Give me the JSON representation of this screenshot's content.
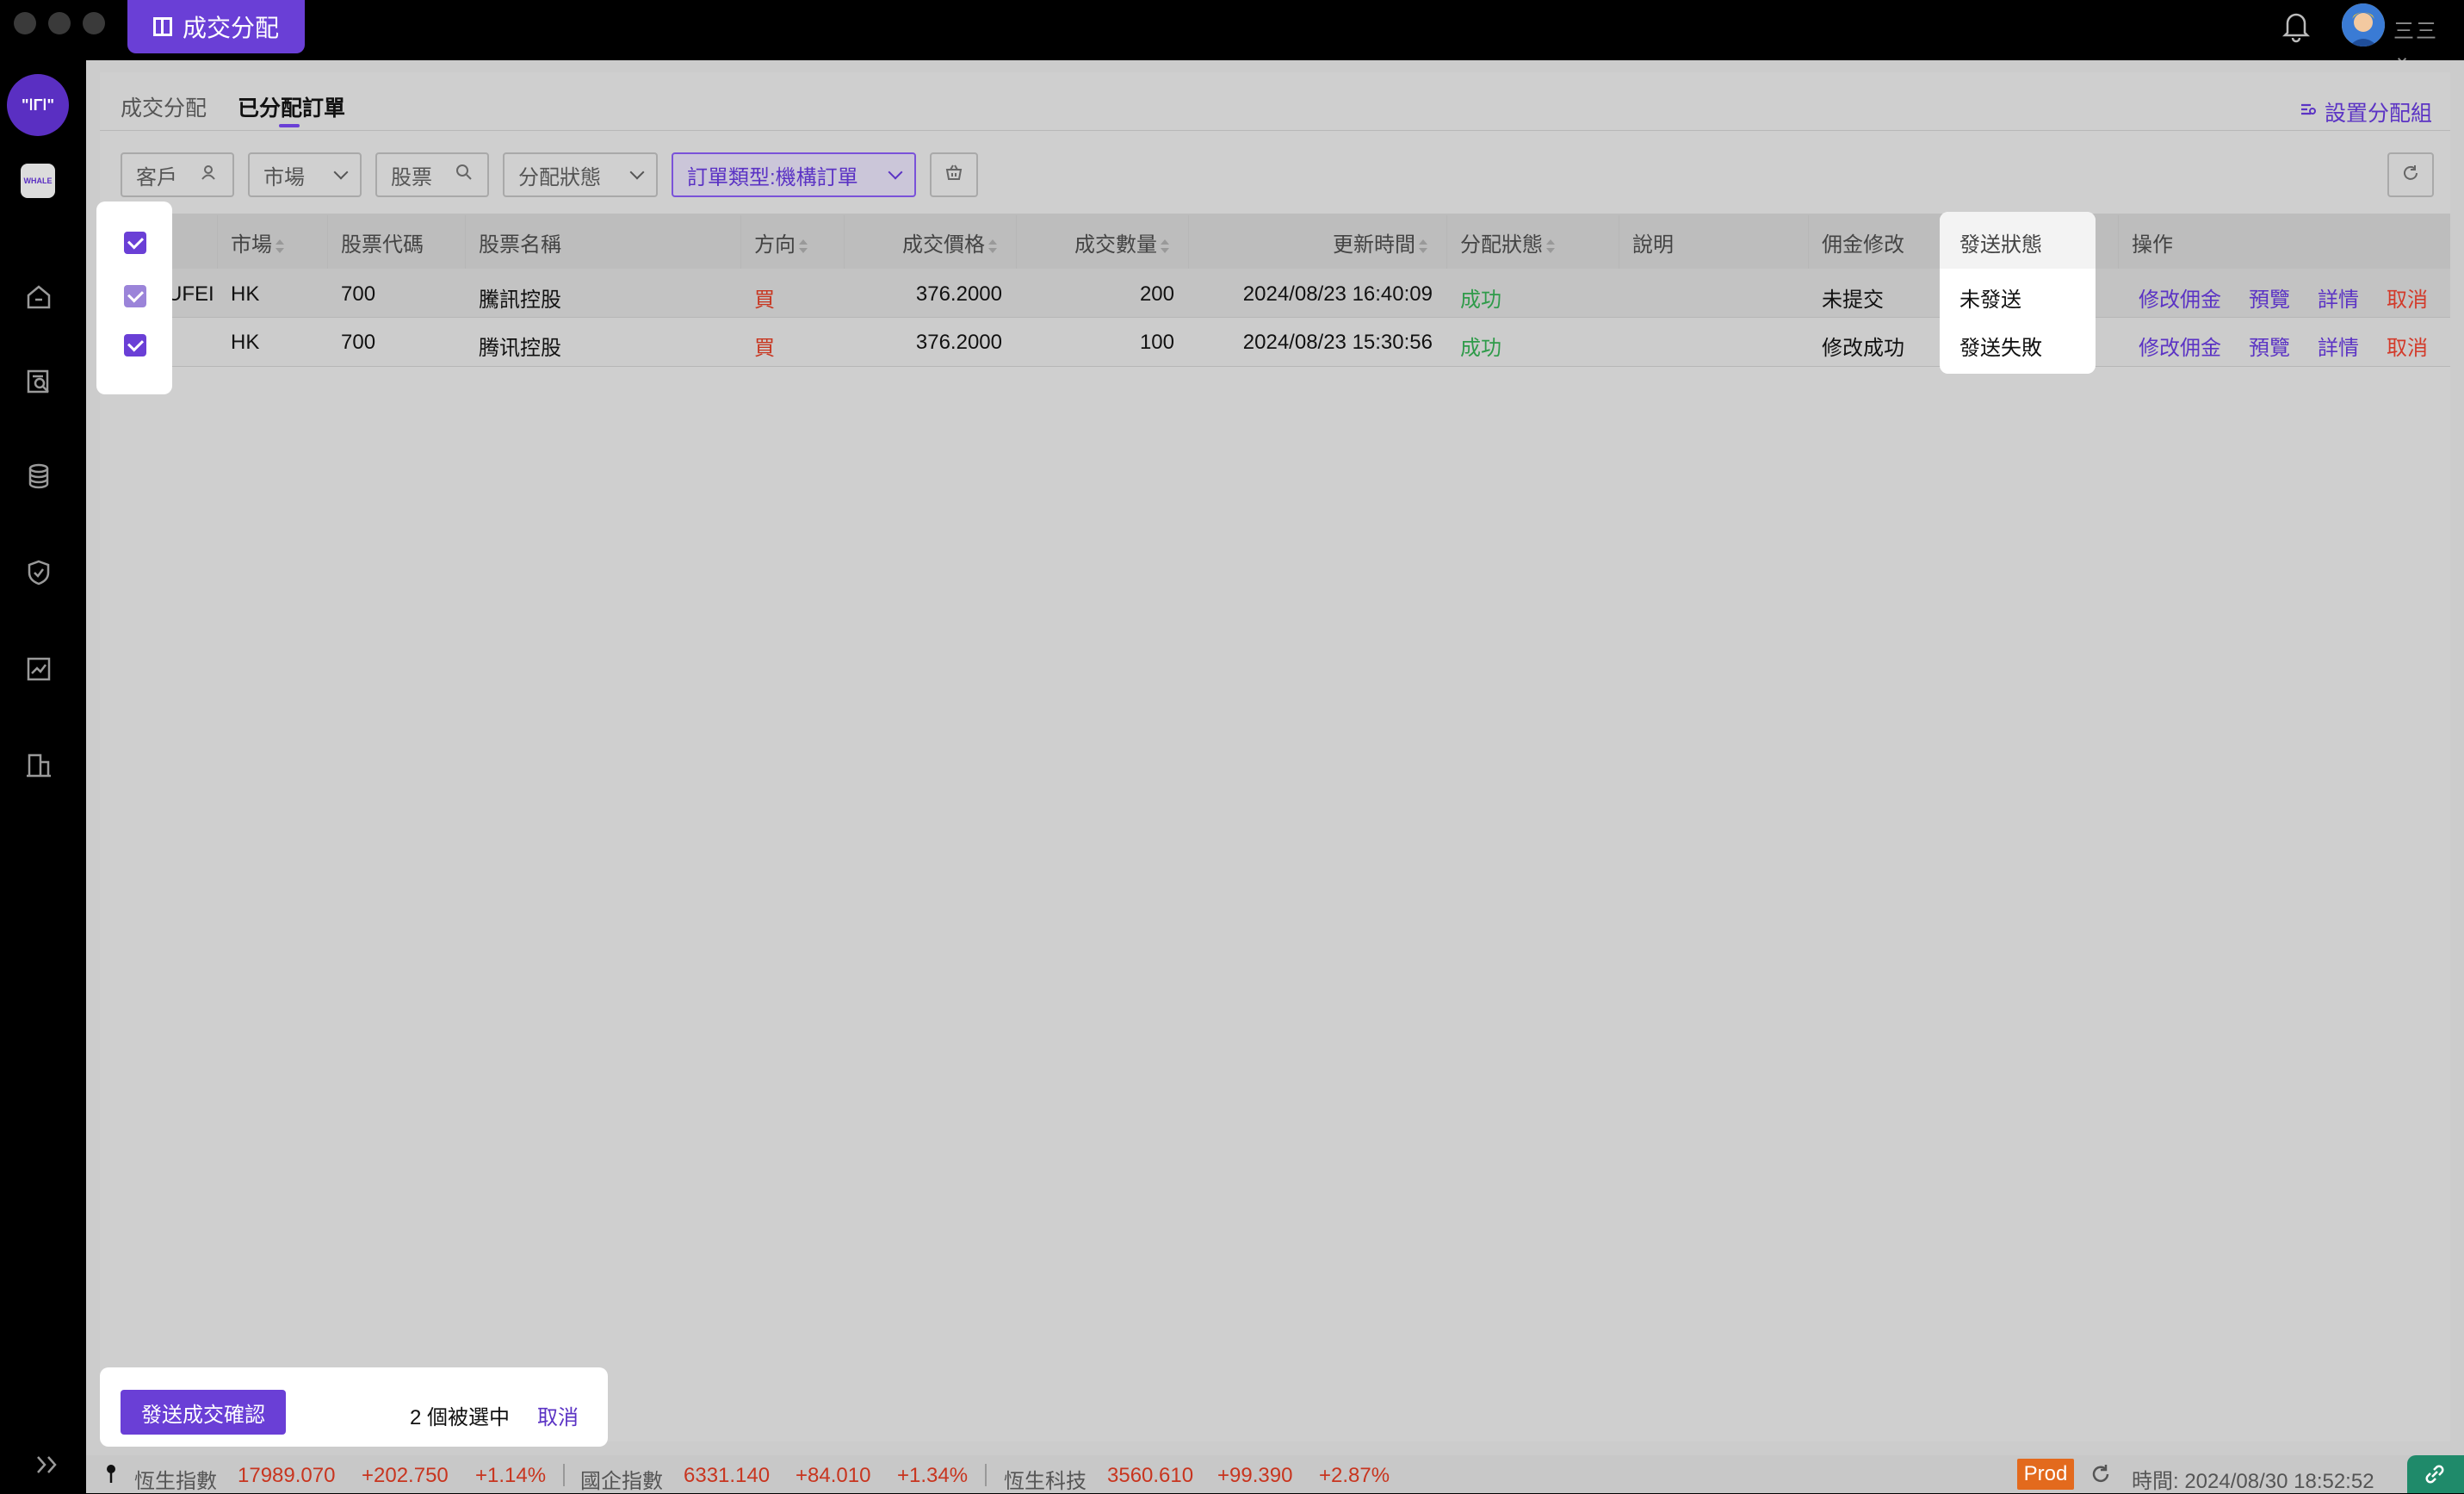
{
  "app": {
    "tab_label": "成交分配"
  },
  "header": {
    "user_label": "三三"
  },
  "tabs": {
    "allocate": "成交分配",
    "allocated_orders": "已分配訂單",
    "settings_link": "設置分配組"
  },
  "filters": {
    "client": "客戶",
    "market": "市場",
    "stock": "股票",
    "status": "分配狀態",
    "order_type": "訂單類型:機構訂單"
  },
  "table": {
    "headers": {
      "market": "市場",
      "code": "股票代碼",
      "name": "股票名稱",
      "side": "方向",
      "price": "成交價格",
      "qty": "成交數量",
      "updated": "更新時間",
      "alloc_status": "分配狀態",
      "note": "說明",
      "commission": "佣金修改",
      "send_status": "發送狀態",
      "ops": "操作"
    },
    "rows": [
      {
        "client": "UFEI",
        "market": "HK",
        "code": "700",
        "name": "騰訊控股",
        "side": "買",
        "price": "376.2000",
        "qty": "200",
        "updated": "2024/08/23 16:40:09",
        "alloc_status": "成功",
        "note": "",
        "commission": "未提交",
        "send_status": "未發送"
      },
      {
        "client": "",
        "market": "HK",
        "code": "700",
        "name": "腾讯控股",
        "side": "買",
        "price": "376.2000",
        "qty": "100",
        "updated": "2024/08/23 15:30:56",
        "alloc_status": "成功",
        "note": "",
        "commission": "修改成功",
        "send_status": "發送失敗"
      }
    ],
    "actions": {
      "modify": "修改佣金",
      "preview": "預覽",
      "detail": "詳情",
      "cancel": "取消"
    }
  },
  "selection": {
    "send_button": "發送成交確認",
    "count_text": "2 個被選中",
    "cancel": "取消"
  },
  "status_bar": {
    "hsi_label": "恆生指數",
    "hsi_value": "17989.070",
    "hsi_change": "+202.750",
    "hsi_pct": "+1.14%",
    "hscei_label": "國企指數",
    "hscei_value": "6331.140",
    "hscei_change": "+84.010",
    "hscei_pct": "+1.34%",
    "hstech_label": "恆生科技",
    "hstech_value": "3560.610",
    "hstech_change": "+99.390",
    "hstech_pct": "+2.87%",
    "env": "Prod",
    "time": "時間: 2024/08/30 18:52:52"
  },
  "colors": {
    "accent": "#6a3fd6",
    "up": "#c8351f",
    "success": "#2f9b4a",
    "env": "#e36a1d"
  },
  "icons": [
    "bell-icon",
    "home-icon",
    "search-doc-icon",
    "database-icon",
    "shield-icon",
    "report-icon",
    "building-icon",
    "expand-icon",
    "refresh-icon",
    "filter-settings-icon",
    "person-icon",
    "search-icon",
    "basket-icon",
    "pin-icon",
    "link-icon"
  ]
}
